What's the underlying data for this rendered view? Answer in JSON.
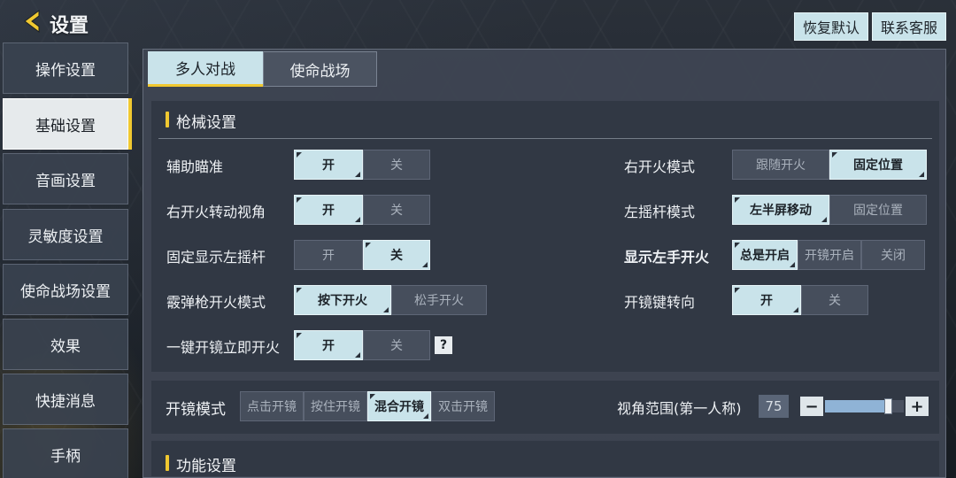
{
  "header": {
    "title": "设置",
    "restore_label": "恢复默认",
    "contact_label": "联系客服"
  },
  "sidebar": {
    "items": [
      {
        "label": "操作设置"
      },
      {
        "label": "基础设置"
      },
      {
        "label": "音画设置"
      },
      {
        "label": "灵敏度设置"
      },
      {
        "label": "使命战场设置"
      },
      {
        "label": "效果"
      },
      {
        "label": "快捷消息"
      },
      {
        "label": "手柄"
      }
    ],
    "active_index": 1
  },
  "tabs": [
    {
      "label": "多人对战"
    },
    {
      "label": "使命战场"
    }
  ],
  "gun_section": {
    "title": "枪械设置",
    "left": [
      {
        "label": "辅助瞄准",
        "options": [
          "开",
          "关"
        ],
        "selected": 0
      },
      {
        "label": "右开火转动视角",
        "options": [
          "开",
          "关"
        ],
        "selected": 0
      },
      {
        "label": "固定显示左摇杆",
        "options": [
          "开",
          "关"
        ],
        "selected": 1
      },
      {
        "label": "霰弹枪开火模式",
        "options": [
          "按下开火",
          "松手开火"
        ],
        "selected": 0
      },
      {
        "label": "一键开镜立即开火",
        "options": [
          "开",
          "关"
        ],
        "selected": 0,
        "help": "?"
      }
    ],
    "right": [
      {
        "label": "右开火模式",
        "options": [
          "跟随开火",
          "固定位置"
        ],
        "selected": 1
      },
      {
        "label": "左摇杆模式",
        "options": [
          "左半屏移动",
          "固定位置"
        ],
        "selected": 0
      },
      {
        "label": "显示左手开火",
        "options": [
          "总是开启",
          "开镜开启",
          "关闭"
        ],
        "selected": 0
      },
      {
        "label": "开镜键转向",
        "options": [
          "开",
          "关"
        ],
        "selected": 0
      }
    ]
  },
  "scope_section": {
    "label": "开镜模式",
    "options": [
      "点击开镜",
      "按住开镜",
      "混合开镜",
      "双击开镜"
    ],
    "selected": 2,
    "fov_label": "视角范围(第一人称)",
    "fov_value": "75",
    "fov_fraction": 0.8,
    "minus": "−",
    "plus": "+"
  },
  "func_section": {
    "title": "功能设置"
  },
  "colors": {
    "accent": "#f0c830",
    "selected": "#c9e3ea",
    "panel": "#3e4552"
  }
}
